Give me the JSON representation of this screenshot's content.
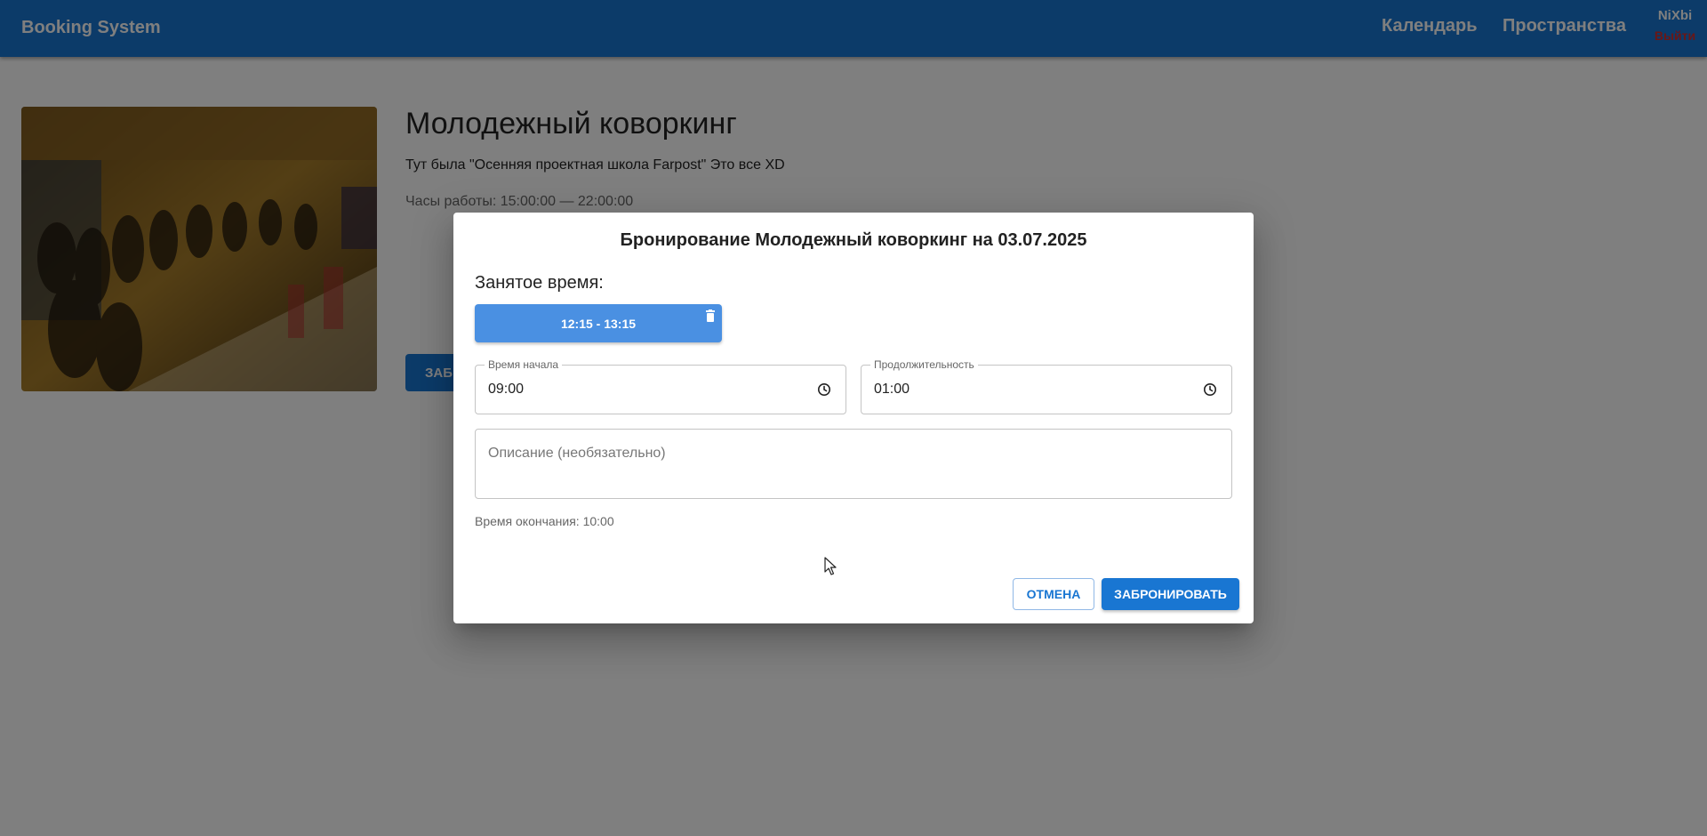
{
  "header": {
    "brand": "Booking System",
    "nav_calendar": "Календарь",
    "nav_spaces": "Пространства",
    "user_name": "NiXbi",
    "logout": "Выйти"
  },
  "space": {
    "title": "Молодежный коворкинг",
    "description": "Тут была \"Осенняя проектная школа Farpost\" Это все XD",
    "hours": "Часы работы: 15:00:00 — 22:00:00",
    "book_button": "ЗАБРОНИРОВАТЬ"
  },
  "dialog": {
    "title": "Бронирование Молодежный коворкинг на 03.07.2025",
    "busy_label": "Занятое время:",
    "busy_slots": [
      "12:15 - 13:15"
    ],
    "start_time": {
      "label": "Время начала",
      "value": "09:00"
    },
    "duration": {
      "label": "Продолжительность",
      "value": "01:00"
    },
    "description": {
      "placeholder": "Описание (необязательно)"
    },
    "end_time": "Время окончания: 10:00",
    "cancel": "ОТМЕНА",
    "submit": "ЗАБРОНИРОВАТЬ"
  },
  "colors": {
    "primary": "#1976d2",
    "busy_chip": "#4a90e2",
    "logout": "#d32f2f",
    "backdrop": "rgba(0,0,0,0.5)"
  },
  "icons": {
    "busy_delete": "trash-icon",
    "time_picker": "clock-icon"
  }
}
